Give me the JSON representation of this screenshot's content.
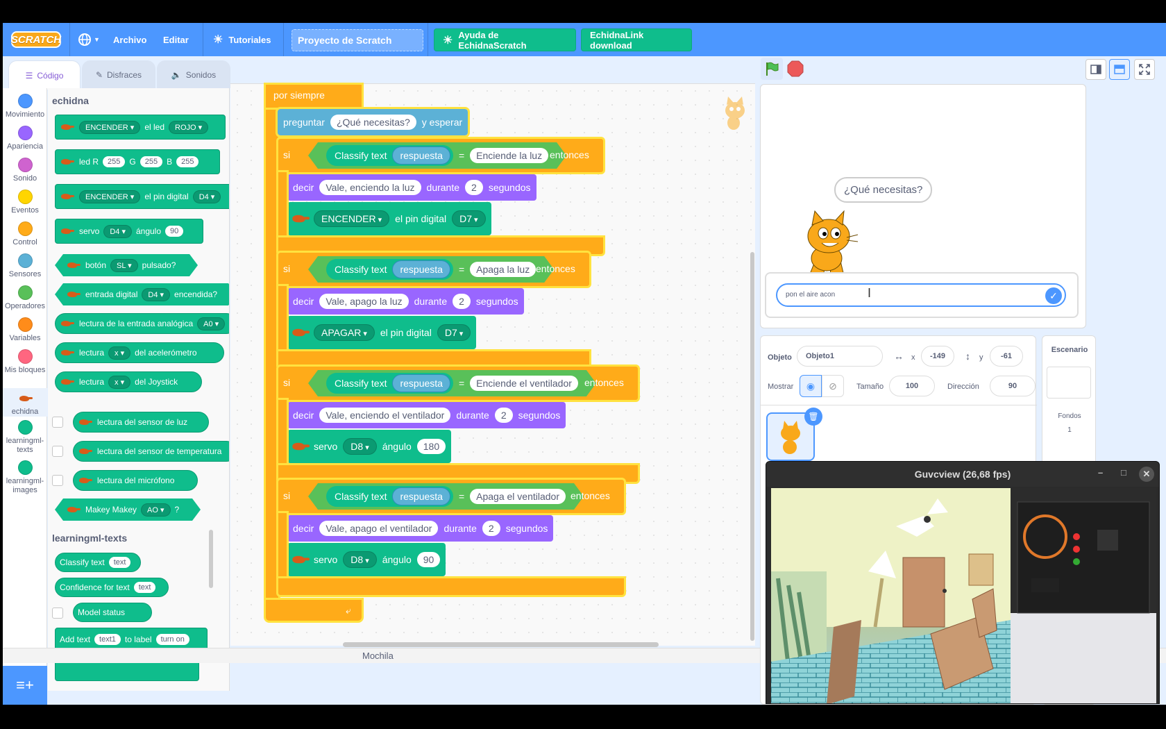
{
  "menu": {
    "logo": "SCRATCH",
    "archivo": "Archivo",
    "editar": "Editar",
    "tutoriales": "Tutoriales",
    "project_title": "Proyecto de Scratch",
    "ayuda": "Ayuda de EchidnaScratch",
    "link": "EchidnaLink download"
  },
  "tabs": {
    "codigo": "Código",
    "disfraces": "Disfraces",
    "sonidos": "Sonidos"
  },
  "categories": [
    {
      "label": "Movimiento",
      "color": "#4c97ff"
    },
    {
      "label": "Apariencia",
      "color": "#9966ff"
    },
    {
      "label": "Sonido",
      "color": "#cf63cf"
    },
    {
      "label": "Eventos",
      "color": "#ffd500"
    },
    {
      "label": "Control",
      "color": "#ffab19"
    },
    {
      "label": "Sensores",
      "color": "#5cb1d6"
    },
    {
      "label": "Operadores",
      "color": "#59c059"
    },
    {
      "label": "Variables",
      "color": "#ff8c1a"
    },
    {
      "label": "Mis bloques",
      "color": "#ff6680"
    },
    {
      "label": "echidna",
      "color": "#d75c1a"
    },
    {
      "label": "learningml-texts",
      "color": "#0fbd8c"
    },
    {
      "label": "learningml-images",
      "color": "#0fbd8c"
    }
  ],
  "palette": {
    "echidna_header": "echidna",
    "b1": {
      "d1": "ENCENDER",
      "t1": "el led",
      "d2": "ROJO"
    },
    "b2": {
      "t1": "led R",
      "v1": "255",
      "t2": "G",
      "v2": "255",
      "t3": "B",
      "v3": "255"
    },
    "b3": {
      "d1": "ENCENDER",
      "t1": "el pin digital",
      "d2": "D4"
    },
    "b4": {
      "t1": "servo",
      "d1": "D4",
      "t2": "ángulo",
      "v1": "90"
    },
    "b5": {
      "t1": "botón",
      "d1": "SL",
      "t2": "pulsado?"
    },
    "b6": {
      "t1": "entrada digital",
      "d1": "D4",
      "t2": "encendida?"
    },
    "b7": {
      "t1": "lectura de la entrada analógica",
      "d1": "A0"
    },
    "b8": {
      "t1": "lectura",
      "d1": "x",
      "t2": "del acelerómetro"
    },
    "b9": {
      "t1": "lectura",
      "d1": "x",
      "t2": "del Joystick"
    },
    "b10": "lectura del sensor de luz",
    "b11": "lectura del sensor de temperatura",
    "b12": "lectura del micrófono",
    "b13": {
      "t1": "Makey Makey",
      "d1": "AO",
      "t2": "?"
    },
    "lml_header": "learningml-texts",
    "l1": {
      "t1": "Classify text",
      "v1": "text"
    },
    "l2": {
      "t1": "Confidence for text",
      "v1": "text"
    },
    "l3": "Model status",
    "l4": {
      "t1": "Add text",
      "v1": "text1",
      "t2": "to label",
      "v2": "turn on"
    }
  },
  "script": {
    "forever": "por siempre",
    "ask": {
      "t1": "preguntar",
      "v1": "¿Qué necesitas?",
      "t2": "y esperar"
    },
    "if_label": "si",
    "then_label": "entonces",
    "classify": "Classify text",
    "answer": "respuesta",
    "eq": "=",
    "say": "decir",
    "during": "durante",
    "seconds": "segundos",
    "pin_label": "el pin digital",
    "servo": "servo",
    "angle": "ángulo",
    "blocks": [
      {
        "match": "Enciende la luz",
        "say": "Vale, enciendo la luz",
        "secs": "2",
        "act": "ENCENDER",
        "pin": "D7"
      },
      {
        "match": "Apaga la luz",
        "say": "Vale, apago la luz",
        "secs": "2",
        "act": "APAGAR",
        "pin": "D7"
      },
      {
        "match": "Enciende el ventilador",
        "say": "Vale, enciendo el ventilador",
        "secs": "2",
        "pin": "D8",
        "angle": "180"
      },
      {
        "match": "Apaga el ventilador",
        "say": "Vale, apago el ventilador",
        "secs": "2",
        "pin": "D8",
        "angle": "90"
      }
    ]
  },
  "backpack": "Mochila",
  "stage": {
    "bubble": "¿Qué necesitas?",
    "answer_value": "pon el aire acon"
  },
  "sprite_info": {
    "objeto_label": "Objeto",
    "objeto_value": "Objeto1",
    "x_label": "x",
    "x_value": "-149",
    "y_label": "y",
    "y_value": "-61",
    "mostrar_label": "Mostrar",
    "size_label": "Tamaño",
    "size_value": "100",
    "dir_label": "Dirección",
    "dir_value": "90"
  },
  "stage_pane": {
    "title": "Escenario",
    "fondos": "Fondos",
    "fondos_count": "1"
  },
  "guvcview": {
    "title": "Guvcview  (26,68 fps)"
  }
}
